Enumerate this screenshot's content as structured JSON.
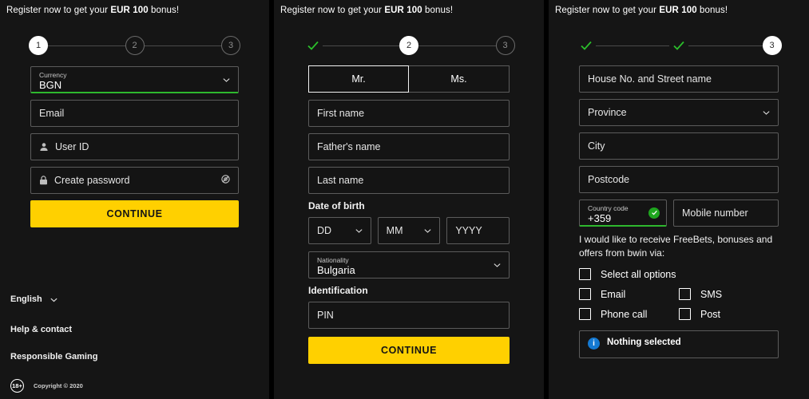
{
  "promo": {
    "prefix": "Register now to get your ",
    "highlight": "EUR 100",
    "suffix": " bonus!"
  },
  "colors": {
    "accent_yellow": "#ffd000",
    "valid_green": "#2eb82e",
    "info_blue": "#1479d1",
    "panel_bg": "#151515",
    "page_bg": "#000000"
  },
  "panel1": {
    "steps": [
      {
        "label": "1",
        "state": "active"
      },
      {
        "label": "2",
        "state": "inactive"
      },
      {
        "label": "3",
        "state": "inactive"
      }
    ],
    "currency": {
      "label": "Currency",
      "value": "BGN",
      "icon": "chevron-down-icon",
      "state": "valid"
    },
    "email": {
      "placeholder": "Email"
    },
    "user_id": {
      "placeholder": "User ID",
      "icon": "user-icon"
    },
    "password": {
      "placeholder": "Create password",
      "icon": "lock-icon",
      "toggle_icon": "eye-off-icon"
    },
    "continue_label": "CONTINUE",
    "footer": {
      "language": "English",
      "language_icon": "chevron-down-icon",
      "help": "Help & contact",
      "responsible": "Responsible Gaming",
      "age_badge": "18+",
      "copyright": "Copyright © 2020"
    }
  },
  "panel2": {
    "steps": [
      {
        "label": "✓",
        "state": "done"
      },
      {
        "label": "2",
        "state": "active"
      },
      {
        "label": "3",
        "state": "inactive"
      }
    ],
    "salutation": {
      "options": [
        "Mr.",
        "Ms."
      ],
      "selected": "Mr."
    },
    "first_name": {
      "placeholder": "First name"
    },
    "fathers_name": {
      "placeholder": "Father's name"
    },
    "last_name": {
      "placeholder": "Last name"
    },
    "dob_label": "Date of birth",
    "dob": {
      "day": {
        "placeholder": "DD",
        "icon": "chevron-down-icon"
      },
      "month": {
        "placeholder": "MM",
        "icon": "chevron-down-icon"
      },
      "year": {
        "placeholder": "YYYY"
      }
    },
    "nationality": {
      "label": "Nationality",
      "value": "Bulgaria",
      "icon": "chevron-down-icon"
    },
    "identification_label": "Identification",
    "pin": {
      "placeholder": "PIN"
    },
    "continue_label": "CONTINUE"
  },
  "panel3": {
    "steps": [
      {
        "label": "✓",
        "state": "done"
      },
      {
        "label": "✓",
        "state": "done"
      },
      {
        "label": "3",
        "state": "active"
      }
    ],
    "street": {
      "placeholder": "House No. and Street name"
    },
    "province": {
      "placeholder": "Province",
      "icon": "chevron-down-icon"
    },
    "city": {
      "placeholder": "City"
    },
    "postcode": {
      "placeholder": "Postcode"
    },
    "country_code": {
      "label": "Country code",
      "value": "+359",
      "state": "valid",
      "icon": "check-circle-icon"
    },
    "mobile": {
      "placeholder": "Mobile number"
    },
    "optin_text": "I would like to receive FreeBets, bonuses and offers from bwin via:",
    "select_all": {
      "label": "Select all options",
      "checked": false
    },
    "options": [
      {
        "label": "Email",
        "checked": false
      },
      {
        "label": "SMS",
        "checked": false
      },
      {
        "label": "Phone call",
        "checked": false
      },
      {
        "label": "Post",
        "checked": false
      }
    ],
    "info": {
      "icon": "info-icon",
      "title": "Nothing selected",
      "subtitle": ""
    }
  }
}
